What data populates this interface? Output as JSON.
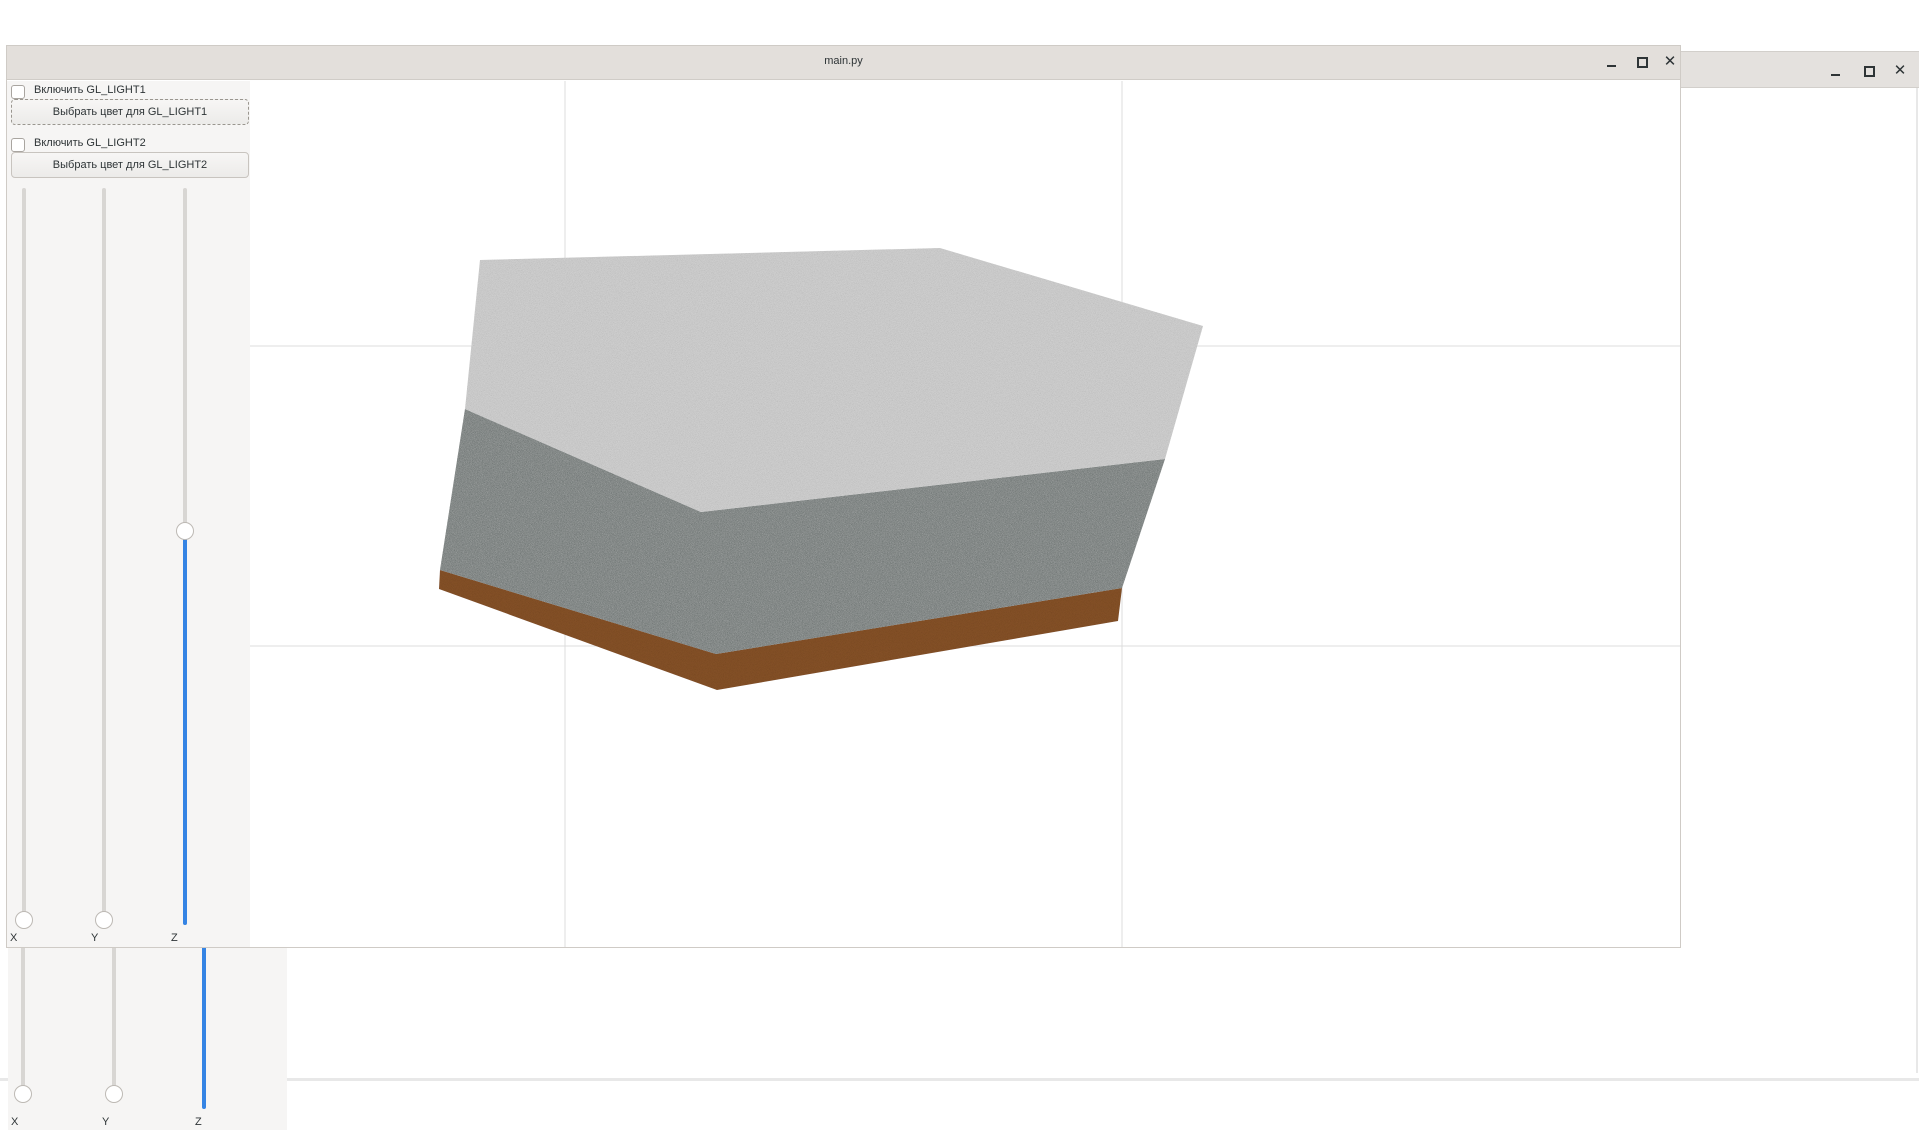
{
  "main_window": {
    "title": "main.py",
    "controls": {
      "minimize": "minimize-icon",
      "maximize": "maximize-icon",
      "close": "✕"
    }
  },
  "background_window": {
    "controls": {
      "minimize": "minimize-icon",
      "maximize": "maximize-icon",
      "close": "✕"
    },
    "sliders": [
      {
        "label": "X",
        "value": 0.0
      },
      {
        "label": "Y",
        "value": 0.0
      },
      {
        "label": "Z",
        "value": 0.47
      }
    ]
  },
  "controls": {
    "light1_checkbox": {
      "label": "Включить GL_LIGHT1",
      "checked": false
    },
    "light1_button": {
      "label": "Выбрать цвет для GL_LIGHT1"
    },
    "light2_checkbox": {
      "label": "Включить GL_LIGHT2",
      "checked": false
    },
    "light2_button": {
      "label": "Выбрать цвет для GL_LIGHT2"
    }
  },
  "sliders": [
    {
      "label": "X",
      "value": 0.0
    },
    {
      "label": "Y",
      "value": 0.0
    },
    {
      "label": "Z",
      "value": 0.535
    }
  ],
  "colors": {
    "accent": "#3584e4",
    "top_layer": "#d4d4d4",
    "middle_layer": "#575f5c",
    "bottom_layer": "#8a5428"
  }
}
